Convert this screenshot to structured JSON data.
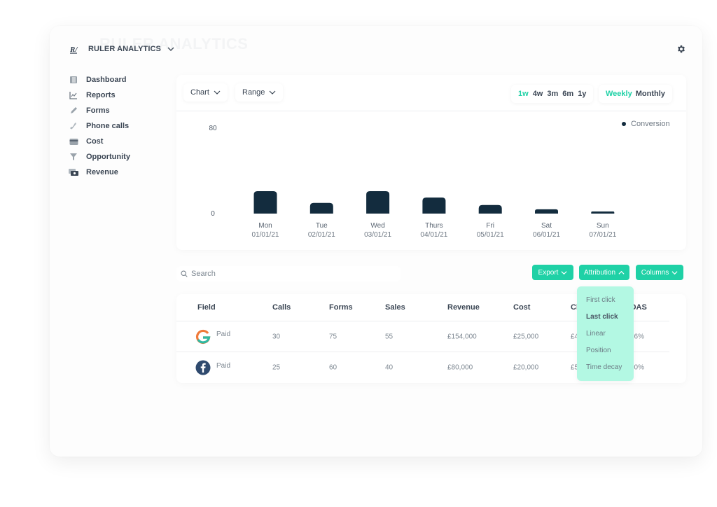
{
  "app": {
    "brand_name": "RULER ANALYTICS",
    "ghost_title": "RULER ANALYTICS",
    "brand_color": "#1fd1a6",
    "bar_color": "#132c3e"
  },
  "sidebar": {
    "items": [
      {
        "label": "Dashboard",
        "icon": "dashboard-icon"
      },
      {
        "label": "Reports",
        "icon": "reports-icon"
      },
      {
        "label": "Forms",
        "icon": "forms-icon"
      },
      {
        "label": "Phone calls",
        "icon": "phone-icon"
      },
      {
        "label": "Cost",
        "icon": "cost-icon"
      },
      {
        "label": "Opportunity",
        "icon": "opportunity-icon"
      },
      {
        "label": "Revenue",
        "icon": "revenue-icon"
      }
    ]
  },
  "chart_panel": {
    "chart_dropdown": "Chart",
    "range_dropdown": "Range",
    "ranges": [
      {
        "label": "1w",
        "active": true
      },
      {
        "label": "4w",
        "active": false
      },
      {
        "label": "3m",
        "active": false
      },
      {
        "label": "6m",
        "active": false
      },
      {
        "label": "1y",
        "active": false
      }
    ],
    "periods": [
      {
        "label": "Weekly",
        "active": true
      },
      {
        "label": "Monthly",
        "active": false
      }
    ]
  },
  "chart_data": {
    "type": "bar",
    "title": "",
    "xlabel": "",
    "ylabel": "",
    "categories": [
      "Mon",
      "Tue",
      "Wed",
      "Thurs",
      "Fri",
      "Sat",
      "Sun"
    ],
    "category_dates": [
      "01/01/21",
      "02/01/21",
      "03/01/21",
      "04/01/21",
      "05/01/21",
      "06/01/21",
      "07/01/21"
    ],
    "series": [
      {
        "name": "Conversion",
        "values": [
          21,
          10,
          21,
          15,
          8,
          4,
          2
        ]
      }
    ],
    "ylim": [
      0,
      80
    ],
    "yticks": [
      0,
      80
    ],
    "legend": {
      "entries": [
        "Conversion"
      ],
      "position": "top-right"
    },
    "grid": false
  },
  "toolbar": {
    "search_placeholder": "Search",
    "export_label": "Export",
    "attribution_label": "Attribution",
    "columns_label": "Columns"
  },
  "attribution_menu": {
    "items": [
      {
        "label": "First click",
        "selected": false
      },
      {
        "label": "Last click",
        "selected": true
      },
      {
        "label": "Linear",
        "selected": false
      },
      {
        "label": "Position",
        "selected": false
      },
      {
        "label": "Time decay",
        "selected": false
      }
    ]
  },
  "table": {
    "headers": [
      "Field",
      "Calls",
      "Forms",
      "Sales",
      "Revenue",
      "Cost",
      "Cl",
      "OAS"
    ],
    "rows": [
      {
        "source": "Google",
        "field": "Paid",
        "calls": "30",
        "forms": "75",
        "sales": "55",
        "revenue": "£154,000",
        "cost": "£25,000",
        "col7": "£4",
        "col8": "16%"
      },
      {
        "source": "Facebook",
        "field": "Paid",
        "calls": "25",
        "forms": "60",
        "sales": "40",
        "revenue": "£80,000",
        "cost": "£20,000",
        "col7": "£5",
        "col8": "00%"
      }
    ]
  }
}
